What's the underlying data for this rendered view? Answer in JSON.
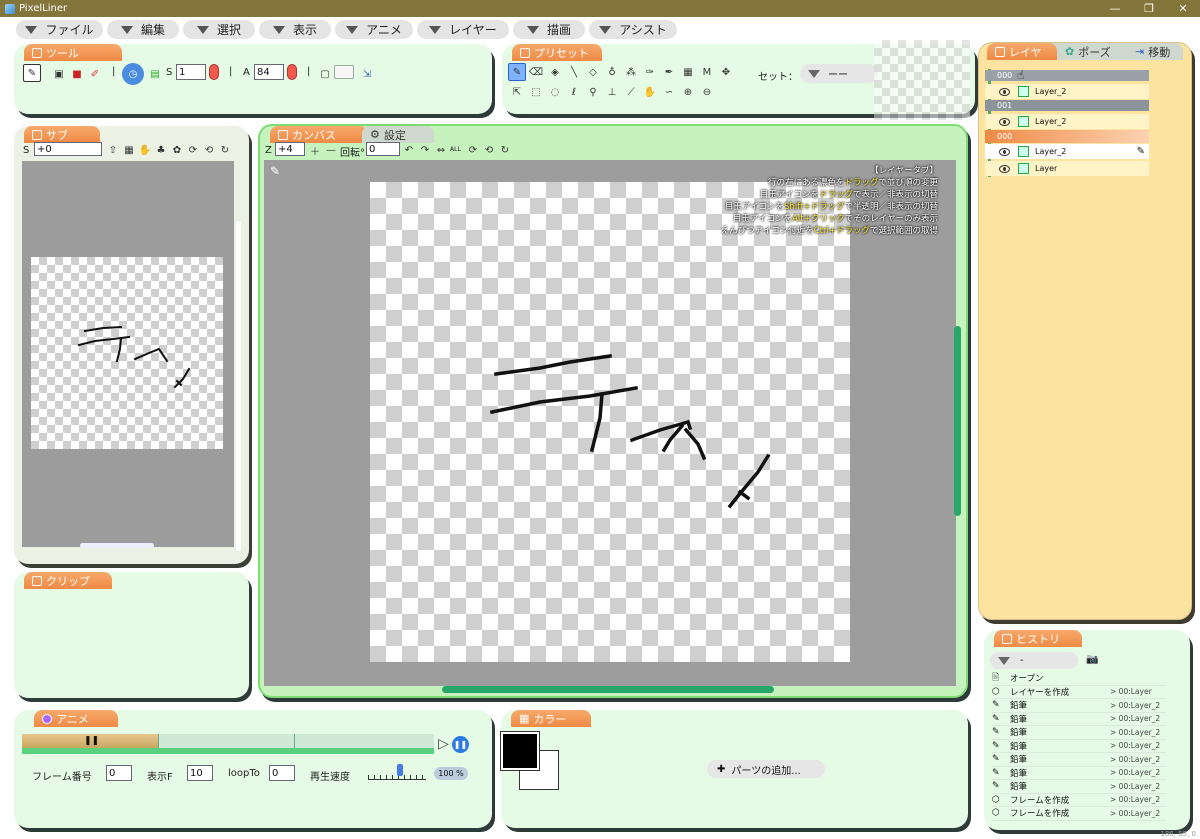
{
  "window": {
    "title": "PixelLiner",
    "minimize": "—",
    "restore": "❐",
    "close": "✕"
  },
  "menu": [
    "ファイル",
    "編集",
    "選択",
    "表示",
    "アニメ",
    "レイヤー",
    "描画",
    "アシスト"
  ],
  "tool_panel": {
    "tab": "ツール",
    "s_label": "S",
    "s_value": "1",
    "a_label": "A",
    "a_value": "84"
  },
  "preset_panel": {
    "tab": "プリセット",
    "set_label": "セット：",
    "set_value": "ーー"
  },
  "sub_panel": {
    "tab": "サブ",
    "s_label": "S",
    "s_value": "+0"
  },
  "clip_panel": {
    "tab": "クリップ"
  },
  "canvas_panel": {
    "tab_canvas": "カンバス",
    "tab_settings": "設定",
    "z_label": "Z",
    "z_value": "+4",
    "rot_label": "回転°",
    "rot_value": "0",
    "all_label": "ALL",
    "help_title": "【レイヤータブ】",
    "help_lines": [
      {
        "pre": "行の左にある濃色を",
        "hl": "ドラッグ",
        "post": "で並び順の変更"
      },
      {
        "pre": "目玉アイコンを",
        "hl": "ドラッグ",
        "post": "で表示／非表示の切替"
      },
      {
        "pre": "目玉アイコンを",
        "hl": "Shift+ドラッグ",
        "post": "で半透明／非表示の切替"
      },
      {
        "pre": "目玉アイコンを",
        "hl": "Alt+クリック",
        "post": "でそのレイヤーのみ表示"
      },
      {
        "pre": "えんぴつアイコン付近を",
        "hl": "Ctrl+ドラッグ",
        "post": "で選択範囲の取得"
      }
    ]
  },
  "layer_panel": {
    "tab_layer": "レイヤ",
    "tab_pose": "ポーズ",
    "tab_move": "移動",
    "groups": [
      {
        "head": "000",
        "layer": "Layer_2",
        "head_color": "#9aa0a8"
      },
      {
        "head": "001",
        "layer": "Layer_2",
        "head_color": "#8c939b"
      },
      {
        "head": "000",
        "layer": "Layer_2",
        "head_color": "#f39a62"
      }
    ],
    "last_layer": "Layer"
  },
  "anime_panel": {
    "tab": "アニメ",
    "frame_label": "フレーム番号",
    "frame_value": "0",
    "show_label": "表示F",
    "show_value": "10",
    "loop_label": "loopTo",
    "loop_value": "0",
    "speed_label": "再生速度",
    "speed_value": "100 %",
    "play_icon": "▷",
    "pause_glyph": "❚❚",
    "speed_level": 0.55
  },
  "color_panel": {
    "tab": "カラー",
    "fg_color": "#000000",
    "bg_color": "#ffffff",
    "add_parts": "パーツの追加..."
  },
  "history_panel": {
    "tab": "ヒストリ",
    "select_value": "-",
    "items": [
      {
        "icon": "doc",
        "name": "オープン",
        "layer": ""
      },
      {
        "icon": "layer",
        "name": "レイヤーを作成",
        "layer": "> 00:Layer"
      },
      {
        "icon": "pencil",
        "name": "鉛筆",
        "layer": "> 00:Layer_2"
      },
      {
        "icon": "pencil",
        "name": "鉛筆",
        "layer": "> 00:Layer_2"
      },
      {
        "icon": "pencil",
        "name": "鉛筆",
        "layer": "> 00:Layer_2"
      },
      {
        "icon": "pencil",
        "name": "鉛筆",
        "layer": "> 00:Layer_2"
      },
      {
        "icon": "pencil",
        "name": "鉛筆",
        "layer": "> 00:Layer_2"
      },
      {
        "icon": "pencil",
        "name": "鉛筆",
        "layer": "> 00:Layer_2"
      },
      {
        "icon": "pencil",
        "name": "鉛筆",
        "layer": "> 00:Layer_2"
      },
      {
        "icon": "layer",
        "name": "フレームを作成",
        "layer": "> 00:Layer_2"
      },
      {
        "icon": "layer",
        "name": "フレームを作成",
        "layer": "> 00:Layer_2"
      }
    ]
  },
  "statusbar": {
    "coords": "186, 55, 0"
  }
}
